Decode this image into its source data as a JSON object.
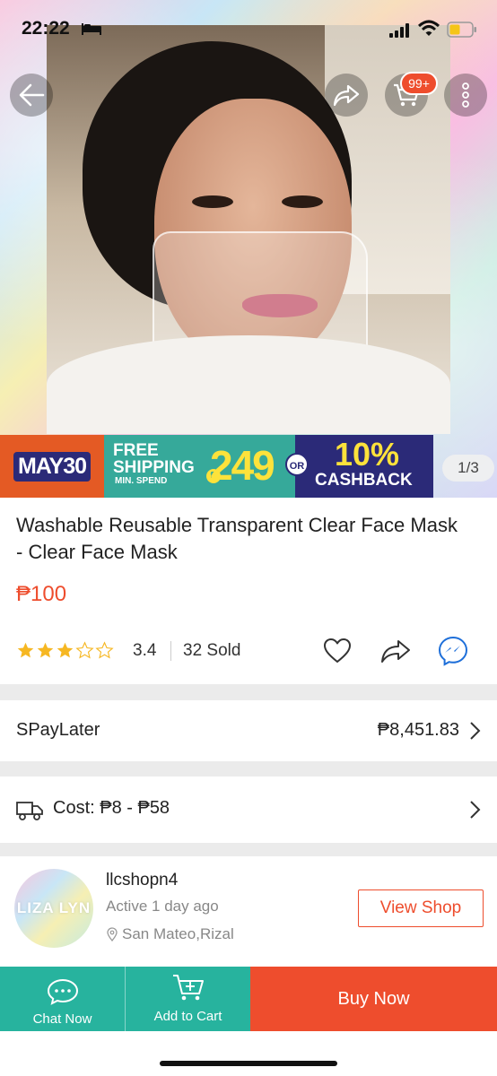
{
  "status_bar": {
    "time": "22:22"
  },
  "hero": {
    "cart_badge": "99+",
    "image_counter": "1/3"
  },
  "promo": {
    "date": "MAY30",
    "free_shipping": "FREE SHIPPING",
    "min_spend": "MIN. SPEND",
    "amount": "249",
    "or": "OR",
    "percent": "10%",
    "cashback": "CASHBACK"
  },
  "product": {
    "title": "Washable Reusable Transparent Clear Face Mask - Clear Face Mask",
    "price": "₱100",
    "rating": "3.4",
    "rating_value": 3.4,
    "sold": "32 Sold"
  },
  "spaylater": {
    "label": "SPayLater",
    "value": "₱8,451.83"
  },
  "shipping": {
    "label": "Cost: ₱8 - ₱58"
  },
  "shop": {
    "name": "llcshopn4",
    "active": "Active 1 day ago",
    "location": "San Mateo,Rizal",
    "view_shop": "View Shop",
    "avatar_text": "LIZA LYN"
  },
  "bottom_bar": {
    "chat": "Chat Now",
    "cart": "Add to Cart",
    "buy": "Buy Now"
  },
  "colors": {
    "accent": "#ee4d2d",
    "teal": "#27b39e"
  }
}
